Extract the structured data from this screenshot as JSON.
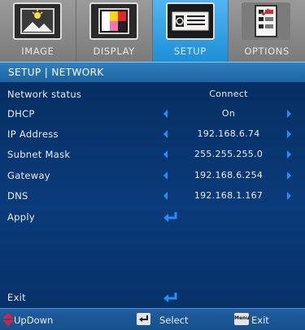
{
  "tabs": [
    {
      "label": "IMAGE",
      "icon": "image-icon",
      "active": false
    },
    {
      "label": "DISPLAY",
      "icon": "display-icon",
      "active": false
    },
    {
      "label": "SETUP",
      "icon": "setup-icon",
      "active": true
    },
    {
      "label": "OPTIONS",
      "icon": "options-icon",
      "active": false
    }
  ],
  "section_title": "SETUP | NETWORK",
  "rows": {
    "network_status": {
      "label": "Network status",
      "value": "Connect"
    },
    "dhcp": {
      "label": "DHCP",
      "value": "On"
    },
    "ip_address": {
      "label": "IP Address",
      "value": "192.168.6.74"
    },
    "subnet_mask": {
      "label": "Subnet Mask",
      "value": "255.255.255.0"
    },
    "gateway": {
      "label": "Gateway",
      "value": "192.168.6.254"
    },
    "dns": {
      "label": "DNS",
      "value": "192.168.1.167"
    },
    "apply": {
      "label": "Apply"
    },
    "exit": {
      "label": "Exit"
    }
  },
  "bottom": {
    "updown": "UpDown",
    "select": "Select",
    "menu_key": "Menu",
    "exit": "Exit"
  },
  "colors": {
    "accent_blue": "#1e8fff",
    "active_tab": "#1c8fd6",
    "updown_icon": "#e0203a"
  }
}
